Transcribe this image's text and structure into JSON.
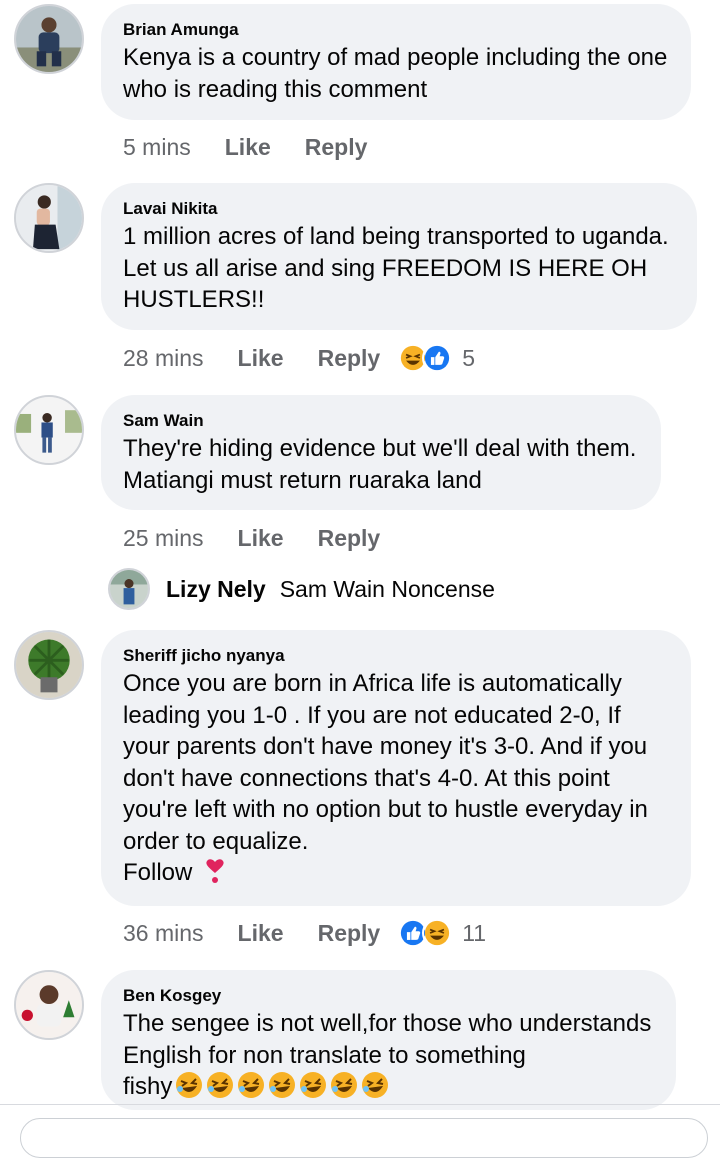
{
  "comments": [
    {
      "author": "Brian Amunga",
      "text": "Kenya is a country of mad people including the one who is reading this comment",
      "time": "5 mins",
      "like": "Like",
      "reply": "Reply"
    },
    {
      "author": "Lavai Nikita",
      "text": "1 million acres of land being transported to uganda. Let us all arise and sing FREEDOM IS HERE OH HUSTLERS!!",
      "time": "28 mins",
      "like": "Like",
      "reply": "Reply",
      "reactions": [
        "haha",
        "like"
      ],
      "reaction_count": "5"
    },
    {
      "author": "Sam Wain",
      "text": "They're hiding evidence but we'll deal with them. Matiangi must return ruaraka land",
      "time": "25 mins",
      "like": "Like",
      "reply": "Reply"
    },
    {
      "author": "Sheriff jicho nyanya",
      "text": "Once you are born in Africa life is automatically leading you 1-0 . If you are not educated 2-0, If your parents don't have money it's 3-0. And if you don't have connections that's 4-0. At this point you're left with no option but to hustle everyday in order to equalize.",
      "text_follow": "Follow",
      "time": "36 mins",
      "like": "Like",
      "reply": "Reply",
      "reactions": [
        "like",
        "haha"
      ],
      "reaction_count": "11"
    },
    {
      "author": "Ben Kosgey",
      "text": "The sengee is not well,for those who understands English for non translate to something",
      "text_tail": "fishy"
    }
  ],
  "reply_preview": {
    "author": "Lizy Nely",
    "text": "Sam Wain Noncense"
  },
  "colors": {
    "bubble": "#f0f2f5",
    "meta": "#65676b",
    "like_blue": "#1877f2",
    "haha_yellow": "#f7b125",
    "heart_red": "#e0245e"
  },
  "icons": [
    "haha-reaction-icon",
    "like-reaction-icon",
    "heart-exclamation-icon",
    "rolling-laughing-icon"
  ]
}
